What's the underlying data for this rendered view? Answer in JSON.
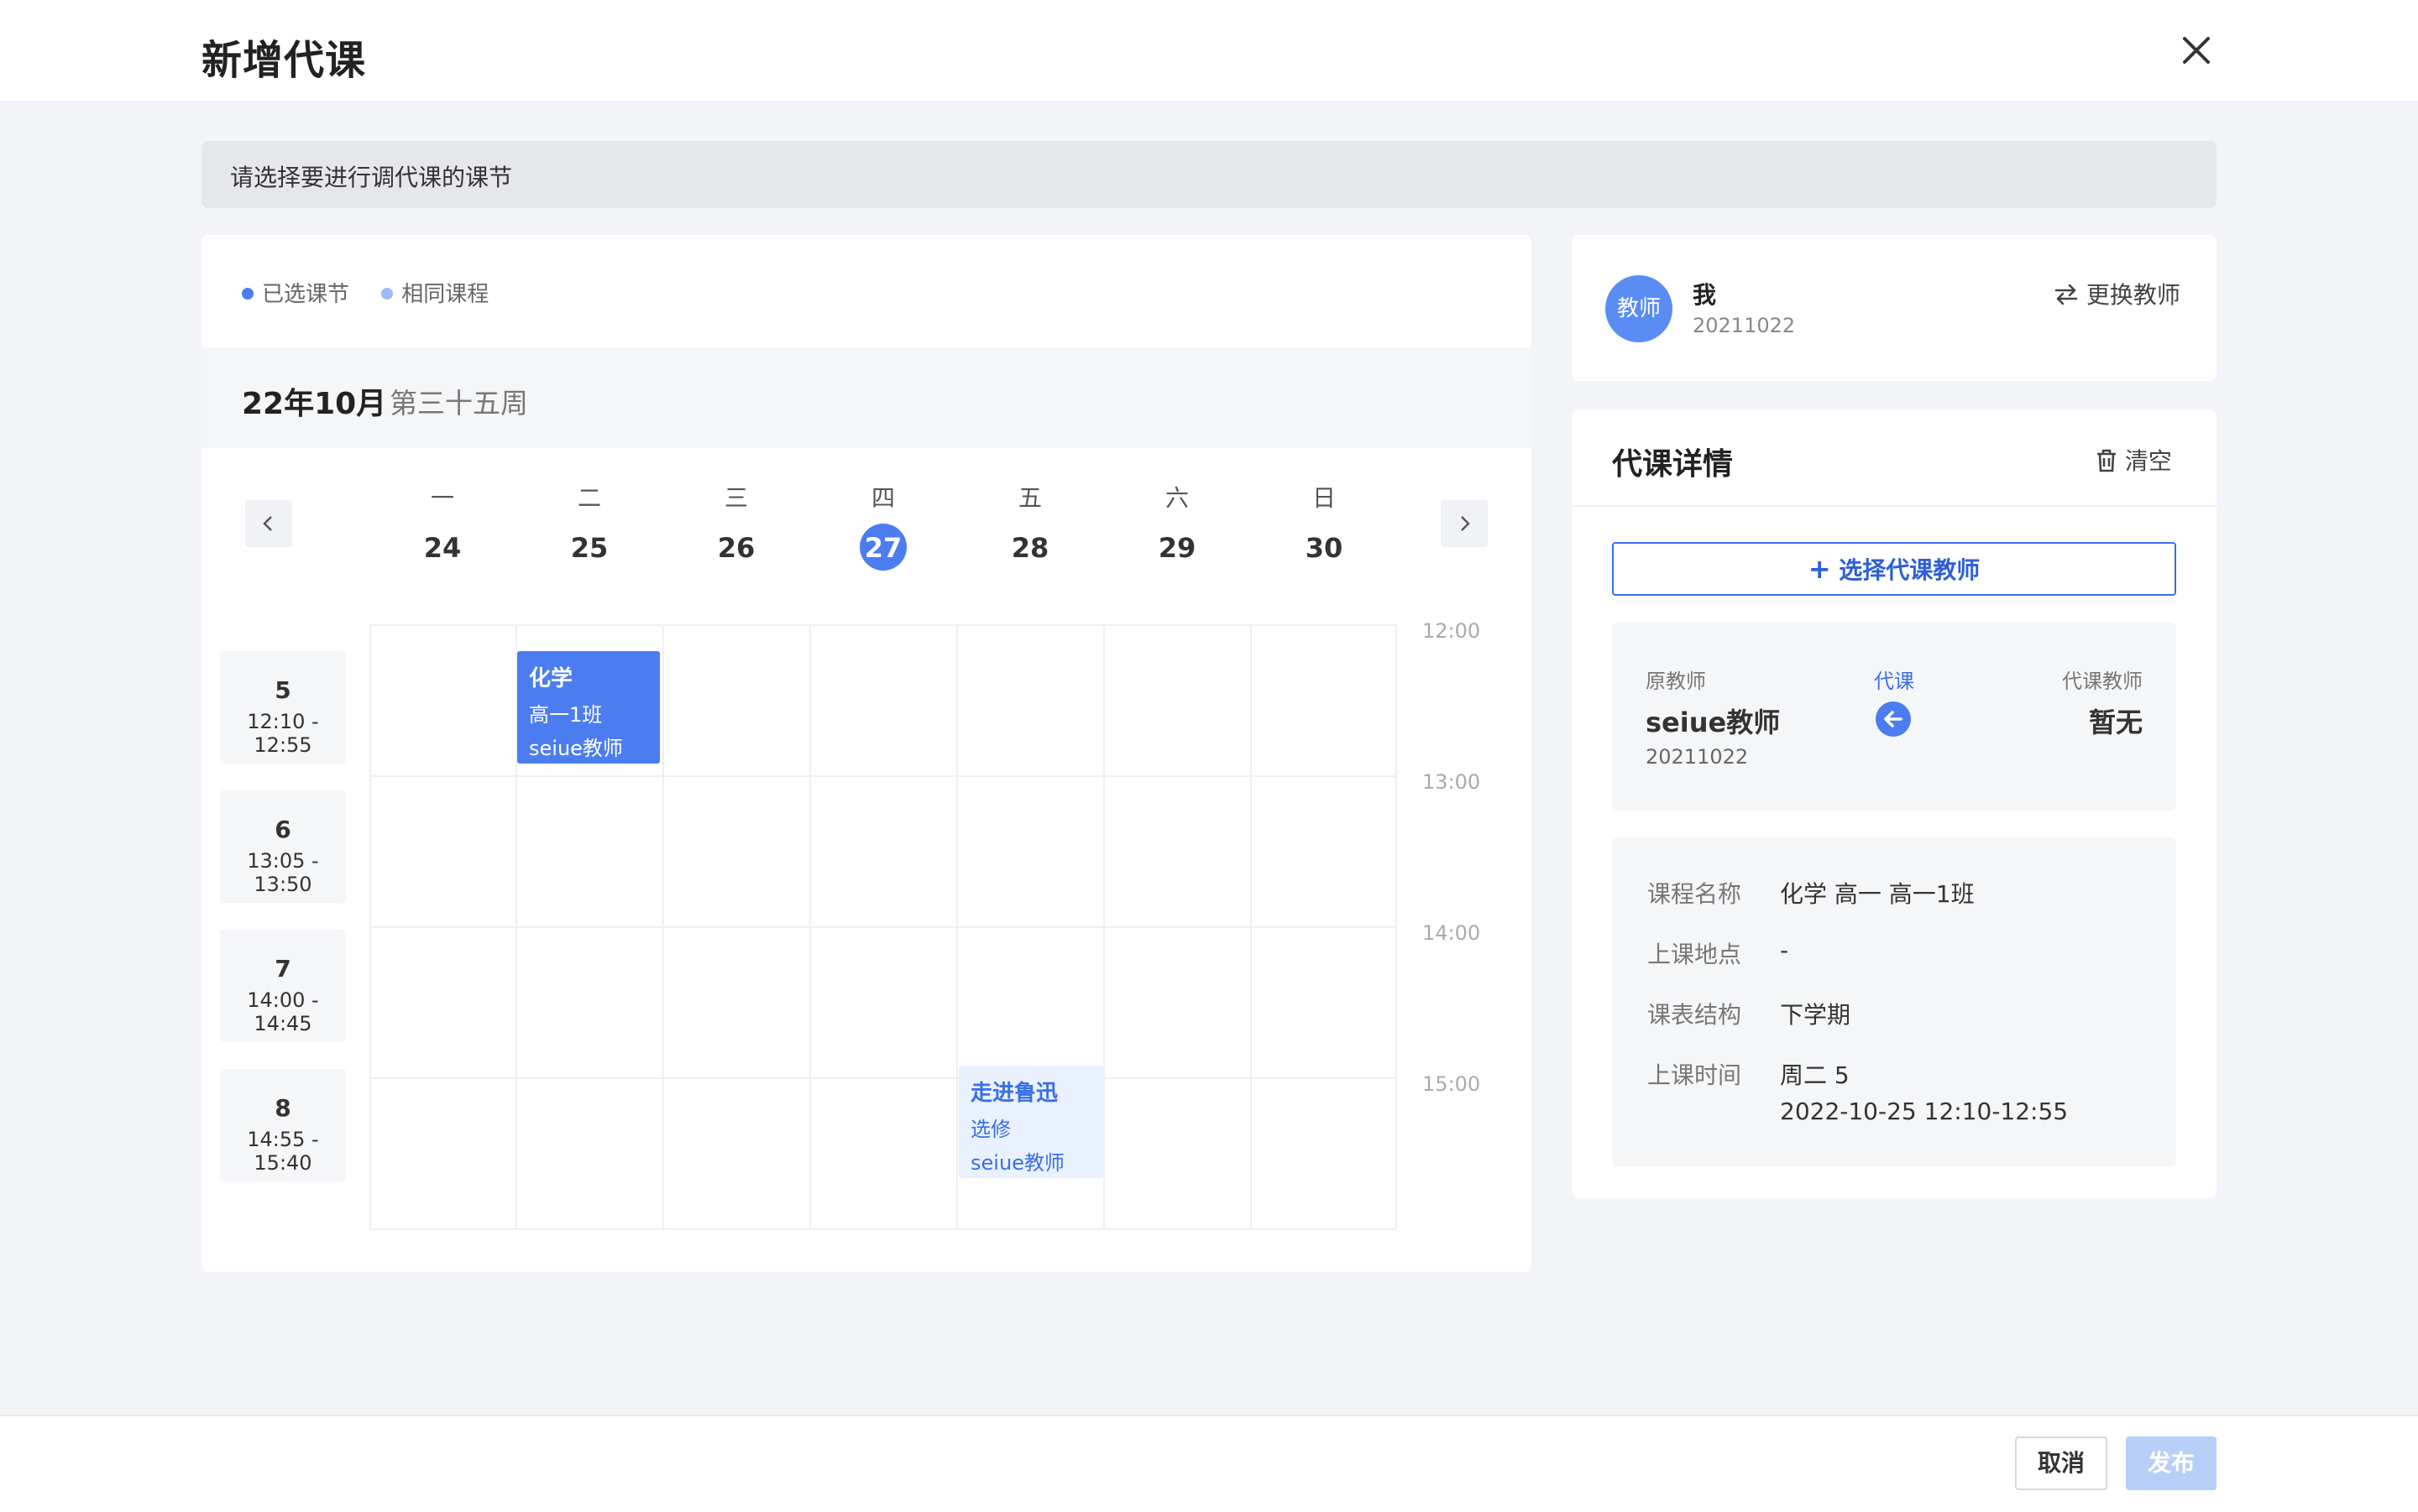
{
  "header": {
    "title": "新增代课"
  },
  "notice": "请选择要进行调代课的课节",
  "legend": [
    {
      "label": "已选课节",
      "color": "#4c7df0"
    },
    {
      "label": "相同课程",
      "color": "#9dbbf7"
    }
  ],
  "calendar": {
    "month": "22年10月",
    "week": "第三十五周",
    "days": [
      {
        "name": "一",
        "num": "24"
      },
      {
        "name": "二",
        "num": "25"
      },
      {
        "name": "三",
        "num": "26"
      },
      {
        "name": "四",
        "num": "27",
        "today": true
      },
      {
        "name": "五",
        "num": "28"
      },
      {
        "name": "六",
        "num": "29"
      },
      {
        "name": "日",
        "num": "30"
      }
    ],
    "periods": [
      {
        "num": "5",
        "time": "12:10 - 12:55"
      },
      {
        "num": "6",
        "time": "13:05 - 13:50"
      },
      {
        "num": "7",
        "time": "14:00 - 14:45"
      },
      {
        "num": "8",
        "time": "14:55 - 15:40"
      }
    ],
    "hours": [
      "12:00",
      "13:00",
      "14:00",
      "15:00"
    ],
    "courses": [
      {
        "subject": "化学",
        "class": "高一1班",
        "teacher": "seiue教师",
        "state": "selected"
      },
      {
        "subject": "走进鲁迅",
        "class": "选修",
        "teacher": "seiue教师",
        "state": "same"
      }
    ]
  },
  "teacher": {
    "avatar": "教师",
    "name": "我",
    "id": "20211022",
    "switch_label": "更换教师"
  },
  "detail": {
    "title": "代课详情",
    "clear_label": "清空",
    "select_label": "选择代课教师",
    "orig_label": "原教师",
    "orig_name": "seiue教师",
    "orig_id": "20211022",
    "mid_label": "代课",
    "sub_label": "代课教师",
    "sub_name": "暂无",
    "rows": [
      {
        "key": "课程名称",
        "value": "化学 高一 高一1班"
      },
      {
        "key": "上课地点",
        "value": "-"
      },
      {
        "key": "课表结构",
        "value": "下学期"
      },
      {
        "key": "上课时间",
        "value": "周二 5"
      }
    ],
    "time_detail": "2022-10-25 12:10-12:55"
  },
  "footer": {
    "cancel": "取消",
    "publish": "发布"
  },
  "colors": {
    "primary": "#4c7df0",
    "same_bg": "#e8f1fd",
    "same_text": "#3a6fe6",
    "publish_disabled": "#b8cff9"
  }
}
